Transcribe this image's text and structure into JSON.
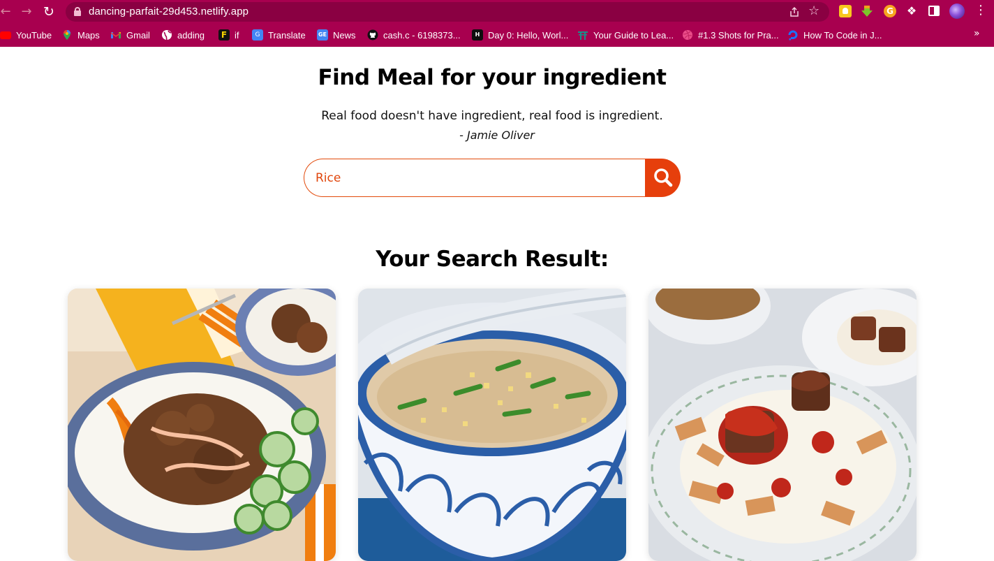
{
  "browser": {
    "url": "dancing-parfait-29d453.netlify.app",
    "bookmarks": [
      {
        "label": "YouTube",
        "icon": "youtube-icon"
      },
      {
        "label": "Maps",
        "icon": "maps-icon"
      },
      {
        "label": "Gmail",
        "icon": "gmail-icon"
      },
      {
        "label": "adding",
        "icon": "globe-icon"
      },
      {
        "label": "if",
        "icon": "f-logo-icon"
      },
      {
        "label": "Translate",
        "icon": "translate-icon"
      },
      {
        "label": "News",
        "icon": "news-icon"
      },
      {
        "label": "cash.c - 6198373...",
        "icon": "github-icon"
      },
      {
        "label": "Day 0: Hello, Worl...",
        "icon": "hackerrank-icon"
      },
      {
        "label": "Your Guide to Lea...",
        "icon": "torii-icon"
      },
      {
        "label": "#1.3 Shots for Pra...",
        "icon": "dribbble-icon"
      },
      {
        "label": "How To Code in J...",
        "icon": "digitalocean-icon"
      }
    ],
    "accent_color": "#a8004f"
  },
  "page": {
    "headline": "Find Meal for your ingredient",
    "quote": "Real food doesn't have ingredient, real food is ingredient.",
    "author": "- Jamie Oliver",
    "search": {
      "value": "Rice",
      "button_icon": "search-icon"
    },
    "results_title": "Your Search Result:",
    "accent_color": "#e63f0c",
    "results": [
      {
        "image": "rice-bowl-with-ground-beef-and-cucumber"
      },
      {
        "image": "rice-porridge-congee-in-blue-bowl"
      },
      {
        "image": "rice-with-beef-and-tomato-sauce"
      }
    ]
  }
}
